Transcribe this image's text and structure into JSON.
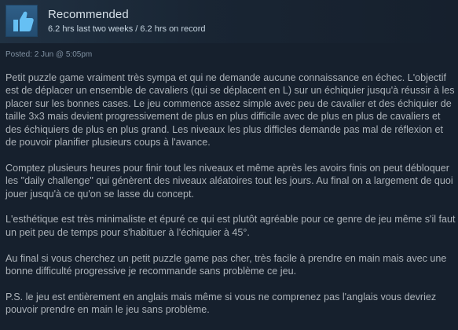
{
  "review": {
    "verdict": "Recommended",
    "hours": "6.2 hrs last two weeks / 6.2 hrs on record",
    "posted": "Posted: 2 Jun @ 5:05pm",
    "paragraphs": [
      "Petit puzzle game vraiment très sympa et qui ne demande aucune connaissance en échec. L'objectif est de déplacer un ensemble de cavaliers (qui se déplacent en L) sur un échiquier jusqu'à réussir à les placer sur les bonnes cases. Le jeu commence assez simple avec peu de cavalier et des échiquier de taille 3x3 mais devient progressivement de plus en plus difficile avec de plus en plus de cavaliers et des échiquiers de plus en plus grand. Les niveaux les plus difficles demande pas mal de réflexion et de pouvoir planifier plusieurs coups à l'avance.",
      "Comptez plusieurs heures pour finir tout les niveaux et même après les avoirs finis on peut débloquer les \"daily challenge\" qui génèrent des niveaux aléatoires tout les jours. Au final on a largement de quoi jouer jusqu'à ce qu'on se lasse du concept.",
      "L'esthétique est très minimaliste et épuré ce qui est plutôt agréable pour ce genre de jeu même s'il faut un peit peu de temps pour s'habituer à l'échiquier à 45°.",
      "Au final si vous cherchez un petit puzzle game pas cher, très facile à prendre en main mais avec une bonne difficulté progressive je recommande sans problème ce jeu.",
      "P.S. le jeu est entièrement en anglais mais même si vous ne comprenez pas l'anglais vous devriez pouvoir prendre en main le jeu sans problème."
    ]
  },
  "icons": {
    "verdict_icon": "thumbs-up-icon"
  },
  "colors": {
    "background": "#16202d",
    "icon_box": "#2f5f88",
    "icon_glyph": "#66c0f4",
    "body_text": "#acb2b8",
    "muted_text": "#8091a2"
  }
}
